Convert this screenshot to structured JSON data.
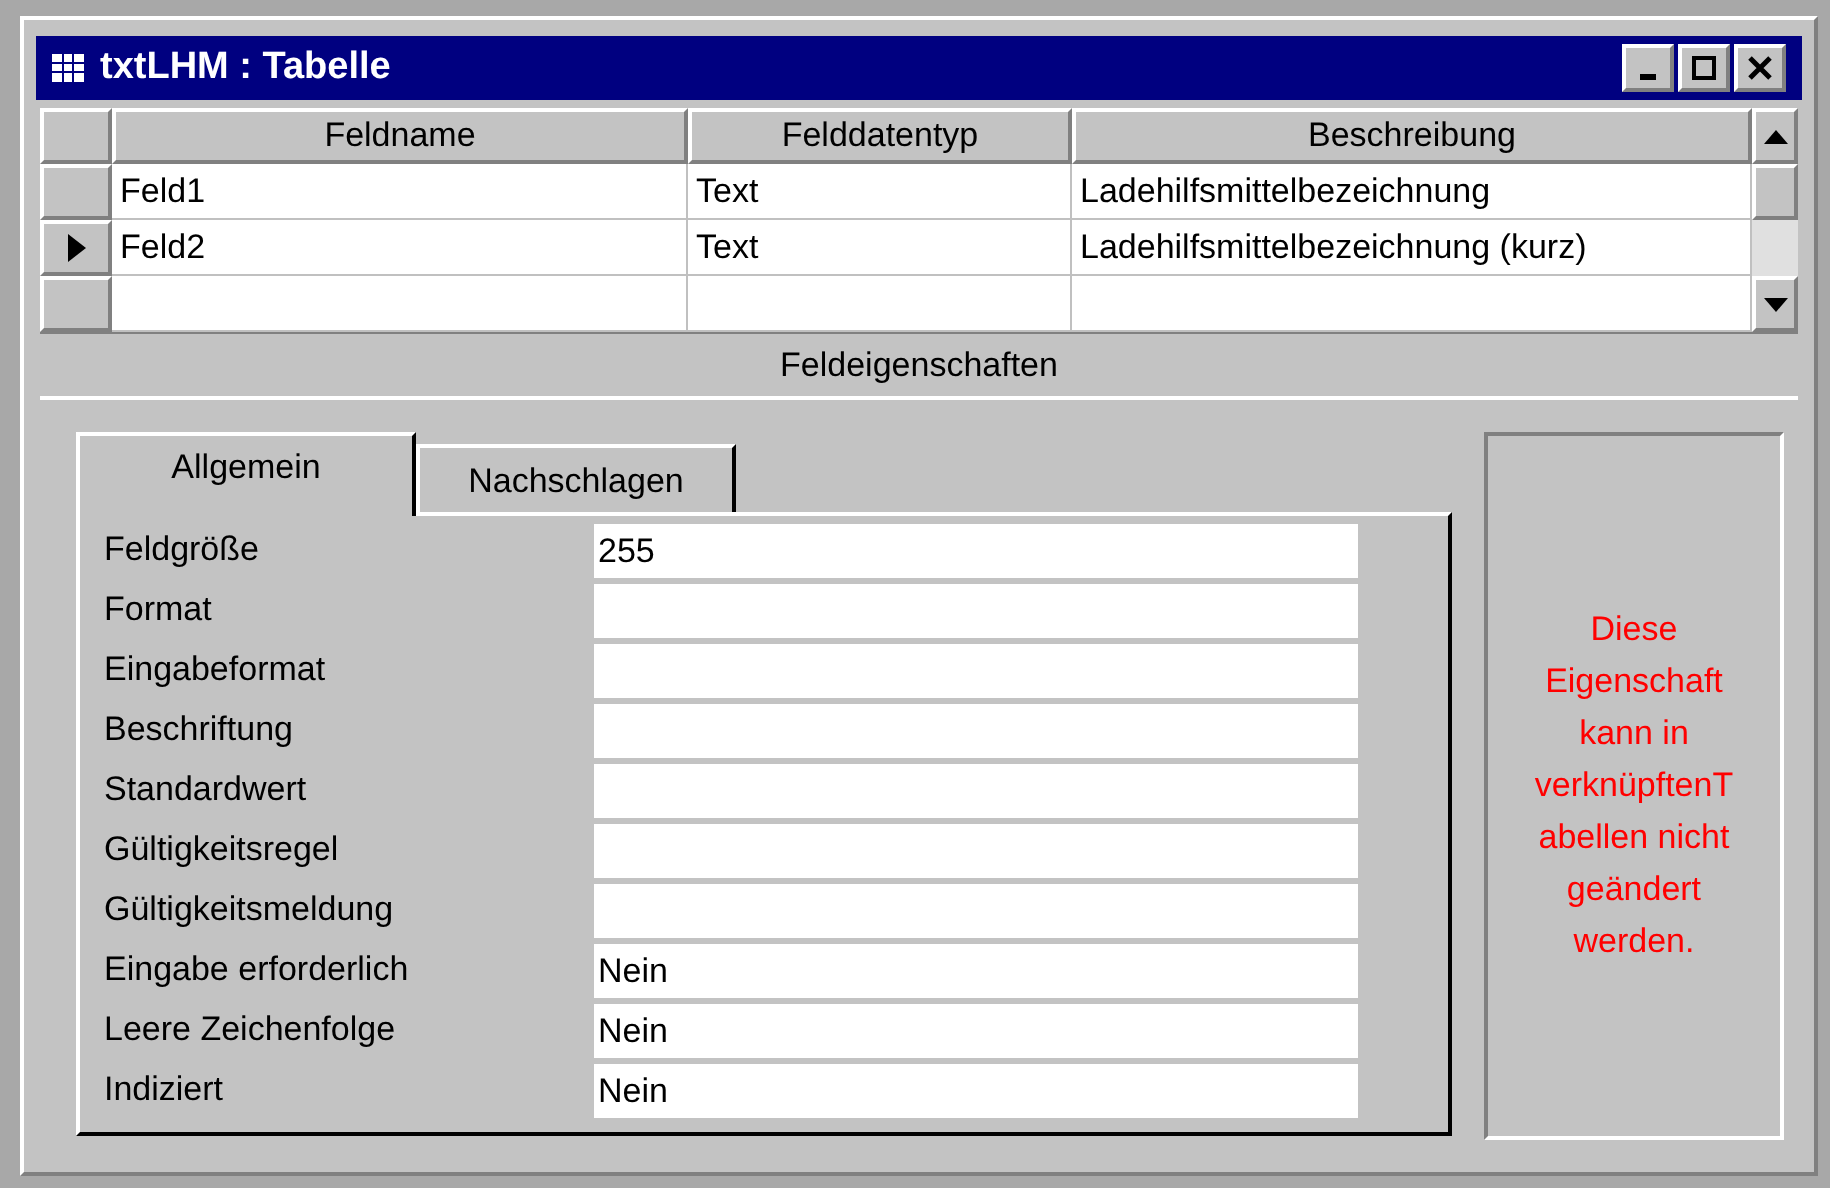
{
  "window": {
    "title": "txtLHM : Tabelle"
  },
  "table": {
    "columns": [
      "Feldname",
      "Felddatentyp",
      "Beschreibung"
    ],
    "rows": [
      {
        "cells": [
          "Feld1",
          "Text",
          "Ladehilfsmittelbezeichnung"
        ],
        "selected": false
      },
      {
        "cells": [
          "Feld2",
          "Text",
          "Ladehilfsmittelbezeichnung (kurz)"
        ],
        "selected": true
      }
    ]
  },
  "section_title": "Feldeigenschaften",
  "tabs": [
    {
      "label": "Allgemein",
      "selected": true
    },
    {
      "label": "Nachschlagen",
      "selected": false
    }
  ],
  "properties": [
    {
      "label": "Feldgröße",
      "value": "255"
    },
    {
      "label": "Format"
    },
    {
      "label": "Eingabeformat"
    },
    {
      "label": "Beschriftung"
    },
    {
      "label": "Standardwert"
    },
    {
      "label": "Gültigkeitsregel"
    },
    {
      "label": "Gültigkeitsmeldung"
    },
    {
      "label": "Eingabe erforderlich",
      "value": "Nein"
    },
    {
      "label": "Leere Zeichenfolge",
      "value": "Nein"
    },
    {
      "label": "Indiziert",
      "value": "Nein"
    }
  ],
  "help_text": "Diese\nEigenschaft\nkann in\nverknüpftenT\nabellen nicht\ngeändert\nwerden."
}
